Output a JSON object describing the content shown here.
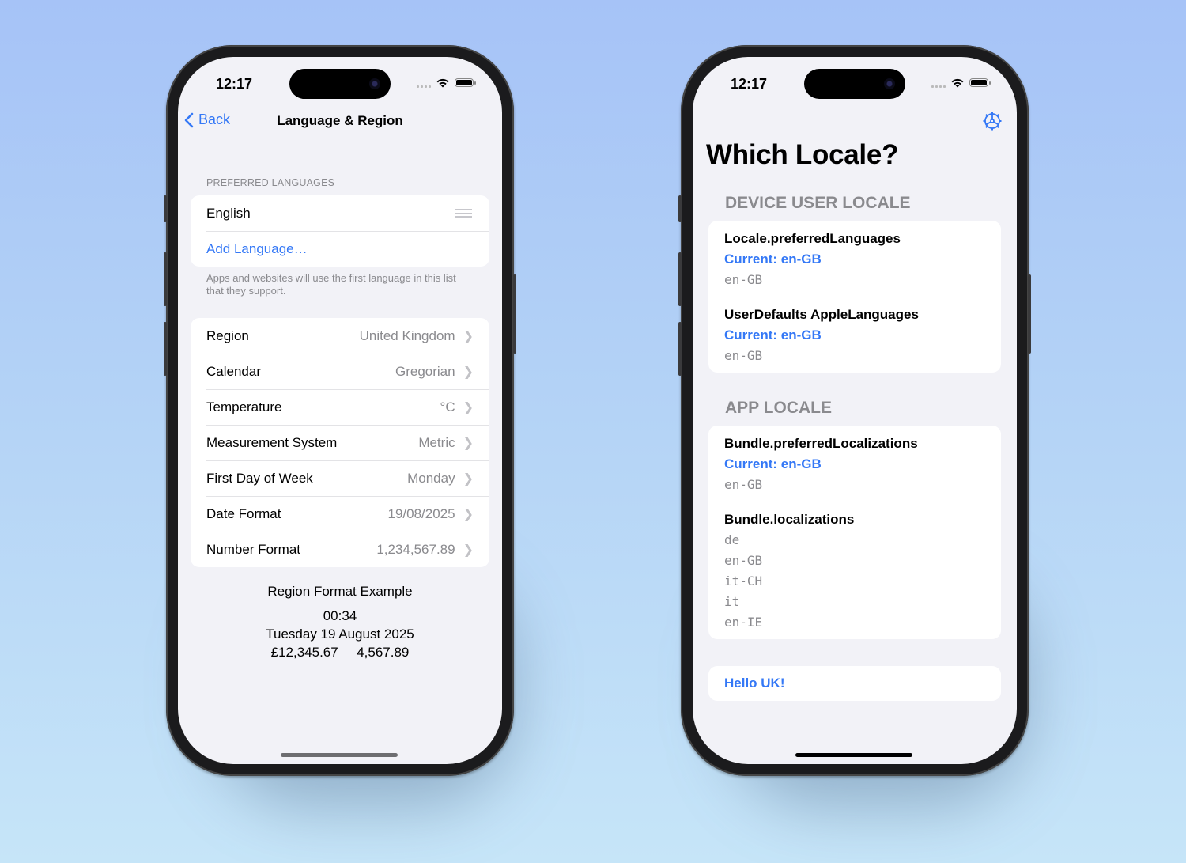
{
  "colors": {
    "accent": "#3478f6",
    "secondary_text": "#8a8a8e",
    "grouped_background": "#f2f2f7"
  },
  "left_phone": {
    "status_bar": {
      "time": "12:17",
      "icons": [
        "cellular-dots-icon",
        "wifi-icon",
        "battery-icon"
      ]
    },
    "nav": {
      "back_label": "Back",
      "title": "Language & Region"
    },
    "preferred_languages": {
      "header": "PREFERRED LANGUAGES",
      "languages": [
        {
          "label": "English",
          "icon": "reorder-handle-icon"
        }
      ],
      "add_label": "Add Language…",
      "footer": "Apps and websites will use the first language in this list that they support."
    },
    "settings": [
      {
        "label": "Region",
        "value": "United Kingdom"
      },
      {
        "label": "Calendar",
        "value": "Gregorian"
      },
      {
        "label": "Temperature",
        "value": "°C"
      },
      {
        "label": "Measurement System",
        "value": "Metric"
      },
      {
        "label": "First Day of Week",
        "value": "Monday"
      },
      {
        "label": "Date Format",
        "value": "19/08/2025"
      },
      {
        "label": "Number Format",
        "value": "1,234,567.89"
      }
    ],
    "region_example": {
      "title": "Region Format Example",
      "time": "00:34",
      "date": "Tuesday 19 August 2025",
      "currency": "£12,345.67",
      "number": "4,567.89"
    }
  },
  "right_phone": {
    "status_bar": {
      "time": "12:17",
      "icons": [
        "cellular-dots-icon",
        "wifi-icon",
        "battery-icon"
      ]
    },
    "toolbar": {
      "settings_icon": "gear-icon"
    },
    "title": "Which Locale?",
    "sections": [
      {
        "header": "DEVICE USER LOCALE",
        "items": [
          {
            "title": "Locale.preferredLanguages",
            "current": "Current: en-GB",
            "values": [
              "en-GB"
            ]
          },
          {
            "title": "UserDefaults AppleLanguages",
            "current": "Current: en-GB",
            "values": [
              "en-GB"
            ]
          }
        ]
      },
      {
        "header": "APP LOCALE",
        "items": [
          {
            "title": "Bundle.preferredLocalizations",
            "current": "Current: en-GB",
            "values": [
              "en-GB"
            ]
          },
          {
            "title": "Bundle.localizations",
            "current": null,
            "values": [
              "de",
              "en-GB",
              "it-CH",
              "it",
              "en-IE"
            ]
          }
        ]
      }
    ],
    "greeting": "Hello UK!"
  }
}
